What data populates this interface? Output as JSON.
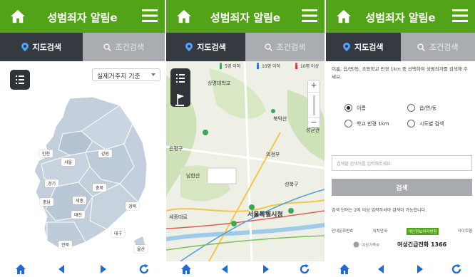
{
  "app": {
    "title": "성범죄자 알림e"
  },
  "tabs": {
    "map": "지도검색",
    "condition": "조건검색"
  },
  "panel1": {
    "select": "실제거주지 기준",
    "regions": [
      "인천",
      "강원",
      "서울",
      "경기",
      "충북",
      "충남",
      "세종",
      "대전",
      "경북",
      "대구",
      "전북",
      "울산"
    ]
  },
  "panel2": {
    "legend": [
      "5명 이하",
      "10명 이하",
      "10명 이상"
    ],
    "labels": [
      "상명대학교",
      "북악산",
      "남한산",
      "성균관",
      "의정부",
      "서울특별시청",
      "세종대로",
      "은평구",
      "성북구"
    ]
  },
  "panel3": {
    "desc": "이름, 읍/면/동, 초등학교 반경 1km 중 선택하여 성범죄자를 검색해 주세요.",
    "options": [
      "이름",
      "읍/면/동",
      "학교 반경 1km",
      "시도별 검색"
    ],
    "placeholder": "검색할 검색어를 입력해주세요.",
    "search_label": "검색",
    "hint": "검색 단어는 2자 이상 입력하셔야 검색이 가능합니다.",
    "footer_links": [
      "안내문화번호",
      "위치안내",
      "개인정보처리방침",
      "사이트맵"
    ],
    "org": "여성가족부",
    "tel": "여성긴급전화 1366"
  },
  "colors": {
    "brand": "#52a317",
    "tab_active": "#343a40",
    "tab_inactive": "#a9adb1"
  }
}
